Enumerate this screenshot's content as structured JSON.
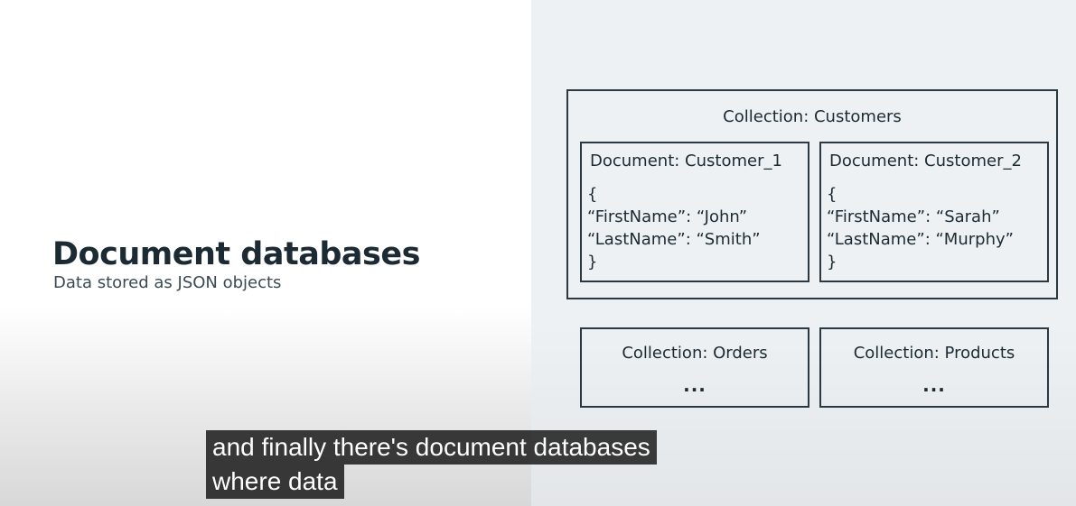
{
  "slide": {
    "title": "Document databases",
    "subtitle": "Data stored as JSON objects"
  },
  "diagram": {
    "outer_collection": {
      "label": "Collection: Customers",
      "documents": [
        {
          "title": "Document: Customer_1",
          "lines": [
            "{",
            "“FirstName”: “John”",
            "“LastName”: “Smith”",
            "}"
          ]
        },
        {
          "title": "Document: Customer_2",
          "lines": [
            "{",
            "“FirstName”: “Sarah”",
            "“LastName”: “Murphy”",
            "}"
          ]
        }
      ]
    },
    "other_collections": [
      {
        "label": "Collection: Orders",
        "ellipsis": "..."
      },
      {
        "label": "Collection: Products",
        "ellipsis": "..."
      }
    ]
  },
  "captions": {
    "lines": [
      "and finally there's document databases",
      "where data"
    ]
  }
}
